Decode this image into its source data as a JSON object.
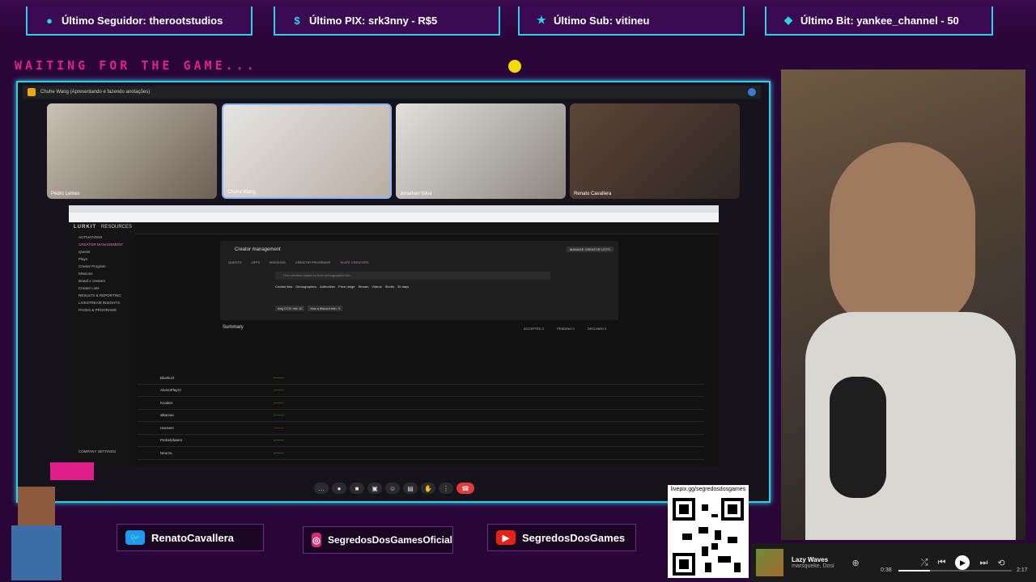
{
  "alerts": [
    {
      "label": "Último Seguidor: therootstudios",
      "icon": "user-icon"
    },
    {
      "label": "Último PIX: srk3nny - R$5",
      "icon": "dollar-icon"
    },
    {
      "label": "Último Sub: vitineu",
      "icon": "star-icon"
    },
    {
      "label": "Último Bit: yankee_channel - 50",
      "icon": "diamond-icon"
    }
  ],
  "waiting_text": "WAITING FOR THE GAME...",
  "meet": {
    "presenting": "Chuhe Wang (Apresentando e fazendo anotações)",
    "participants": [
      "Pedro Lemes",
      "Chuhe Wang",
      "Jonathan Silva",
      "Renato Cavallera"
    ]
  },
  "app": {
    "brand": "LURKIT",
    "resources": "RESOURCES",
    "sidebar": [
      "ACTIVATIONS",
      "CREATOR MANAGEMENT",
      "Quests",
      "Plays",
      "Creator Program",
      "Missions",
      "Brand x creators",
      "Creator Lists",
      "RESULTS & REPORTING",
      "LIVESTREAM INSIGHTS",
      "PAGES & PROGRAMS"
    ],
    "company_settings": "COMPANY SETTINGS",
    "panel_title": "Creator management",
    "panel_tabs": [
      "QUESTS",
      "OFFS",
      "MISSIONS",
      "CREATOR PROGRAMS",
      "SLATE CREATORS"
    ],
    "manage_button": "MANAGE CREATOR LISTS",
    "search_placeholder": "Find creators based on their demographics etc.",
    "filters": [
      "Creator lists",
      "Demographics",
      "Authorities",
      "Price range",
      "Stream",
      "Videos",
      "Shorts",
      "30 days"
    ],
    "chips": [
      "Avg CCV: min 10",
      "Has a discord min: 3"
    ],
    "summary": "Summary",
    "summary_counts": [
      "ACCEPTED 2",
      "PENDING 0",
      "DECLINED 0"
    ],
    "creators": [
      "Bluekurz",
      "AlvaroPlayzz",
      "Knoktrn",
      "alkamas",
      "Hacnem",
      "Prebelofwiers",
      "Neurzu"
    ]
  },
  "socials": [
    {
      "label": "RenatoCavallera",
      "icon": "twitter-icon",
      "color": "#1d9bf0"
    },
    {
      "label": "SegredosDosGamesOficial",
      "icon": "instagram-icon",
      "color": "#d62976"
    },
    {
      "label": "SegredosDosGames",
      "icon": "youtube-icon",
      "color": "#e62117"
    }
  ],
  "qr": {
    "label": "livepix.gg/segredosdosgames"
  },
  "music": {
    "title": "Lazy Waves",
    "artist": "marsqueke, Dosi",
    "elapsed": "0:38",
    "total": "2:17",
    "progress": 0.28
  }
}
